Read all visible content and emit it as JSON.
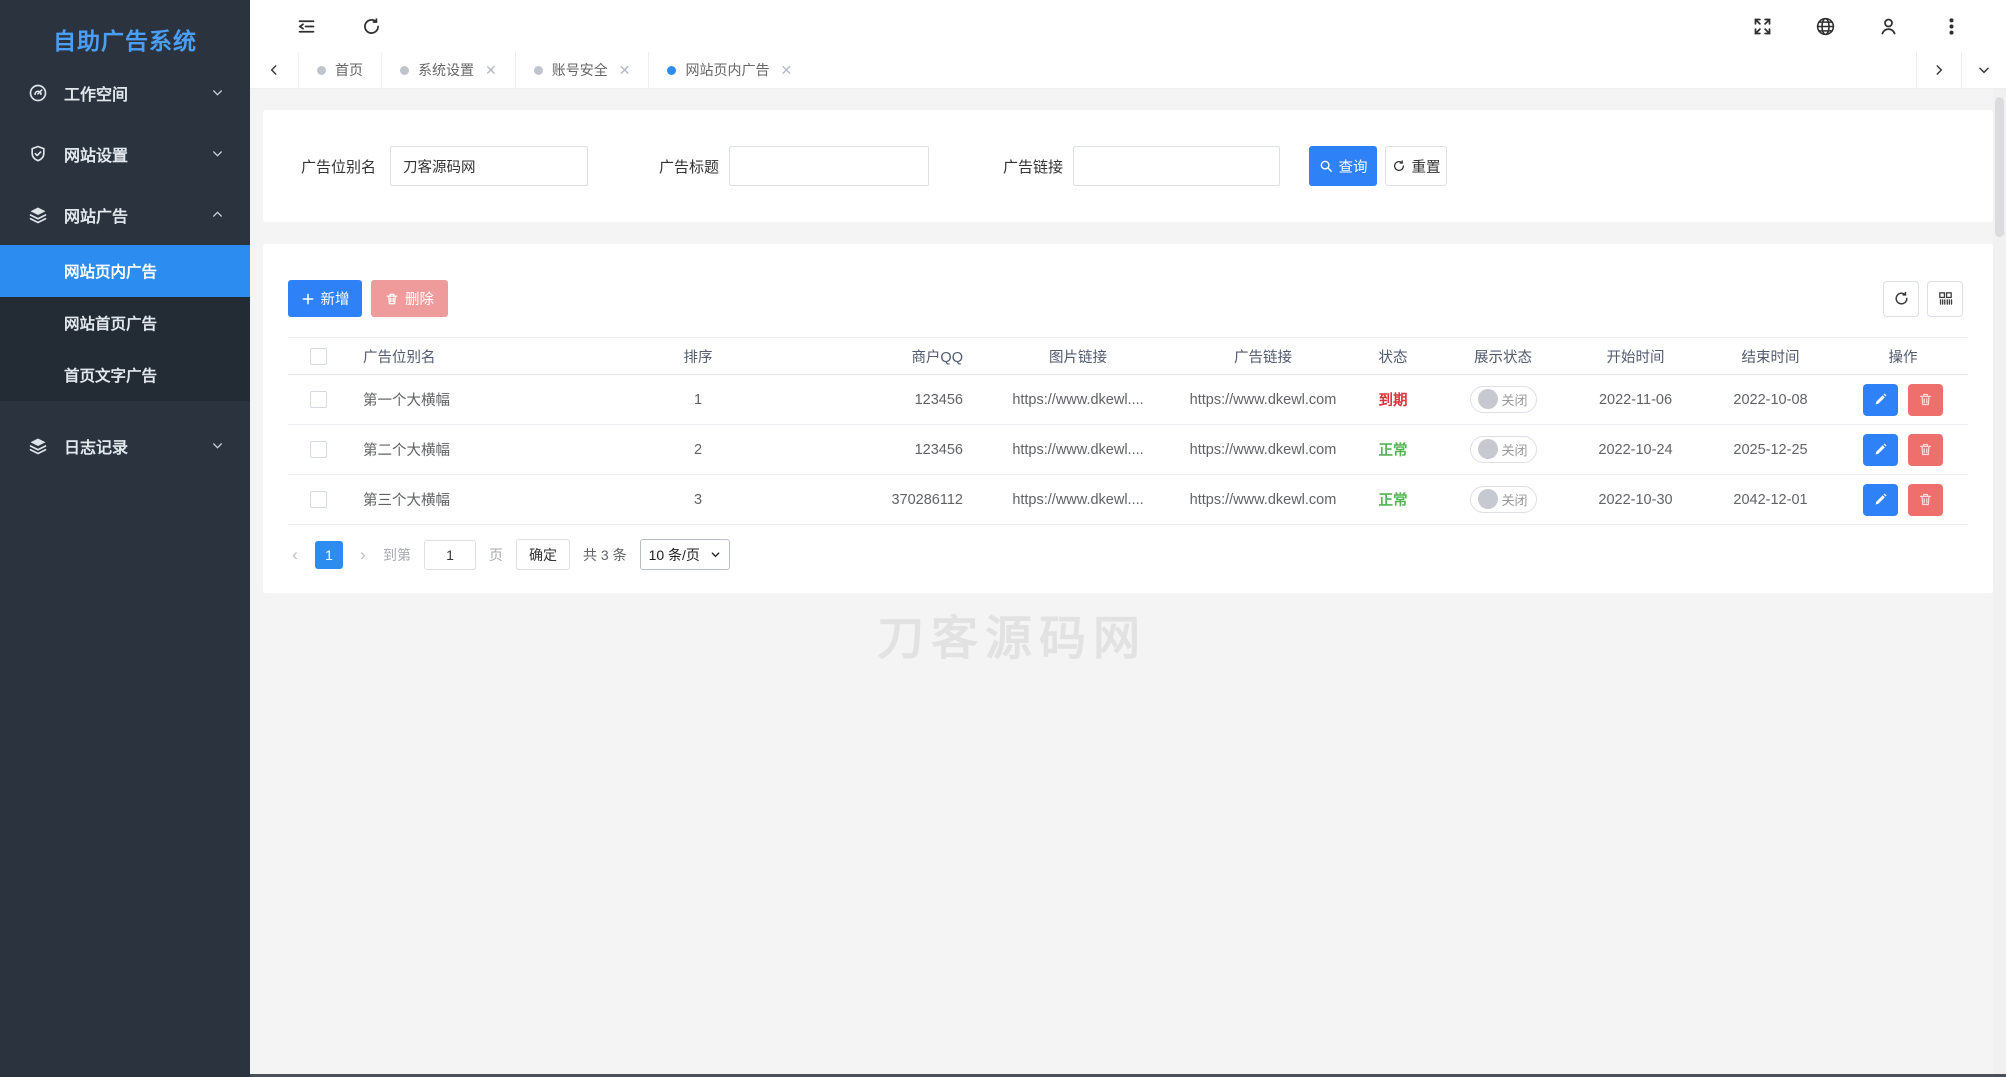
{
  "sidebar": {
    "title": "自助广告系统",
    "menu": [
      {
        "label": "工作空间",
        "icon": "dashboard-icon",
        "state": "collapsed"
      },
      {
        "label": "网站设置",
        "icon": "shield-icon",
        "state": "collapsed"
      },
      {
        "label": "网站广告",
        "icon": "layers-icon",
        "state": "expanded",
        "children": [
          {
            "label": "网站页内广告",
            "active": true
          },
          {
            "label": "网站首页广告",
            "active": false
          },
          {
            "label": "首页文字广告",
            "active": false
          }
        ]
      },
      {
        "label": "日志记录",
        "icon": "layers-icon",
        "state": "collapsed"
      }
    ]
  },
  "tabs": [
    {
      "label": "首页",
      "closable": false,
      "active": false
    },
    {
      "label": "系统设置",
      "closable": true,
      "active": false
    },
    {
      "label": "账号安全",
      "closable": true,
      "active": false
    },
    {
      "label": "网站页内广告",
      "closable": true,
      "active": true
    }
  ],
  "tab_close_glyph": "✕",
  "search": {
    "fields": [
      {
        "label": "广告位别名",
        "value": "刀客源码网"
      },
      {
        "label": "广告标题",
        "value": ""
      },
      {
        "label": "广告链接",
        "value": ""
      }
    ],
    "query_label": "查询",
    "reset_label": "重置"
  },
  "toolbar": {
    "add_label": "新增",
    "delete_label": "删除"
  },
  "table": {
    "headers": [
      "广告位别名",
      "排序",
      "商户QQ",
      "图片链接",
      "广告链接",
      "状态",
      "展示状态",
      "开始时间",
      "结束时间",
      "操作"
    ],
    "rows": [
      {
        "alias": "第一个大横幅",
        "order": "1",
        "qq": "123456",
        "img": "https://www.dkewl....",
        "link": "https://www.dkewl.com",
        "status": "到期",
        "status_type": "expired",
        "display": "关闭",
        "start": "2022-11-06",
        "end": "2022-10-08"
      },
      {
        "alias": "第二个大横幅",
        "order": "2",
        "qq": "123456",
        "img": "https://www.dkewl....",
        "link": "https://www.dkewl.com",
        "status": "正常",
        "status_type": "normal",
        "display": "关闭",
        "start": "2022-10-24",
        "end": "2025-12-25"
      },
      {
        "alias": "第三个大横幅",
        "order": "3",
        "qq": "370286112",
        "img": "https://www.dkewl....",
        "link": "https://www.dkewl.com",
        "status": "正常",
        "status_type": "normal",
        "display": "关闭",
        "start": "2022-10-30",
        "end": "2042-12-01"
      }
    ]
  },
  "pagination": {
    "prev": "‹",
    "current_page": "1",
    "next": "›",
    "goto_prefix": "到第",
    "goto_value": "1",
    "goto_suffix": "页",
    "confirm_label": "确定",
    "total_label": "共 3 条",
    "page_size": "10 条/页"
  },
  "watermark": "刀客源码网",
  "colors": {
    "accent": "#2d8cf0",
    "primary_button": "#2e81f7",
    "danger_disabled": "#f09b9b",
    "row_delete": "#ee6f6c",
    "status_expired": "#d9363e",
    "status_normal": "#53b552",
    "sidebar_bg": "#2b333e",
    "submenu_bg": "#232b35",
    "page_bg": "#f4f4f5"
  }
}
